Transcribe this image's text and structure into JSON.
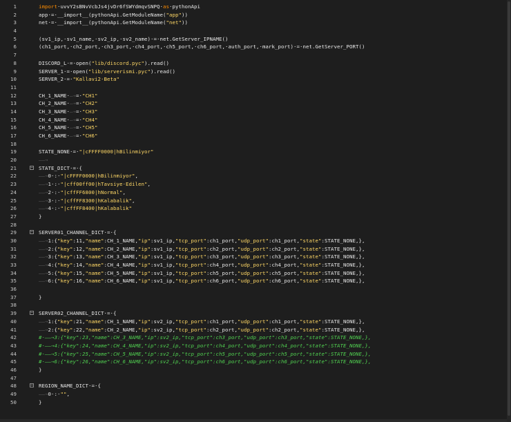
{
  "editor": {
    "lines": [
      {
        "n": "1",
        "code": "import·uvvY2sBNvVcbJs4jvDr6fSWYdmqvSNPQ·as·pythonApi",
        "type": "kw"
      },
      {
        "n": "2",
        "code": "app·=·__import__(pythonApi.GetModuleName(\"app\"))",
        "type": "normal"
      },
      {
        "n": "3",
        "code": "net·=·__import__(pythonApi.GetModuleName(\"net\"))",
        "type": "normal"
      },
      {
        "n": "4",
        "code": "",
        "type": "normal"
      },
      {
        "n": "5",
        "code": "(sv1_ip,·sv1_name,·sv2_ip,·sv2_name)·=·net.GetServer_IPNAME()",
        "type": "normal"
      },
      {
        "n": "6",
        "code": "(ch1_port,·ch2_port,·ch3_port,·ch4_port,·ch5_port,·ch6_port,·auth_port,·mark_port)·=·net.GetServer_PORT()",
        "type": "normal"
      },
      {
        "n": "7",
        "code": "",
        "type": "normal"
      },
      {
        "n": "8",
        "code": "DISCORD_L·=·open(\"lib/discord.pyc\").read()",
        "type": "normal"
      },
      {
        "n": "9",
        "code": "SERVER_1·=·open(\"lib/serverismi.pyc\").read()",
        "type": "normal"
      },
      {
        "n": "10",
        "code": "SERVER_2·=·\"Kallavi2·Beta\"",
        "type": "normal"
      },
      {
        "n": "11",
        "code": "",
        "type": "normal"
      },
      {
        "n": "12",
        "code": "CH_1_NAME·—→=·\"CH1\"",
        "type": "normal"
      },
      {
        "n": "13",
        "code": "CH_2_NAME·—→=·\"CH2\"",
        "type": "normal"
      },
      {
        "n": "14",
        "code": "CH_3_NAME·—→=·\"CH3\"",
        "type": "normal"
      },
      {
        "n": "15",
        "code": "CH_4_NAME·—→=·\"CH4\"",
        "type": "normal"
      },
      {
        "n": "16",
        "code": "CH_5_NAME·—→=·\"CH5\"",
        "type": "normal"
      },
      {
        "n": "17",
        "code": "CH_6_NAME·—→=·\"CH6\"",
        "type": "normal"
      },
      {
        "n": "18",
        "code": "",
        "type": "normal"
      },
      {
        "n": "19",
        "code": "STATE_NONE·=·\"|cFFFF0000|hBilinmiyor\"",
        "type": "normal"
      },
      {
        "n": "20",
        "code": "——→",
        "type": "normal"
      },
      {
        "n": "21",
        "code": "STATE_DICT·=·{",
        "type": "normal",
        "fold": true
      },
      {
        "n": "22",
        "code": "——→0·:·\"|cFFFF0000|hBilinmiyor\",",
        "type": "normal"
      },
      {
        "n": "23",
        "code": "——→1·:·\"|cff00ff00|hTavsiye·Edilen\",",
        "type": "normal"
      },
      {
        "n": "24",
        "code": "——→2·:·\"|cffFF6800|hNormal\",",
        "type": "normal"
      },
      {
        "n": "25",
        "code": "——→3·:·\"|cffFF8300|hKalabalik\",",
        "type": "normal"
      },
      {
        "n": "26",
        "code": "——→4·:·\"|cffFF8400|hKalabalik\"",
        "type": "normal"
      },
      {
        "n": "27",
        "code": "}",
        "type": "normal"
      },
      {
        "n": "28",
        "code": "",
        "type": "normal"
      },
      {
        "n": "29",
        "code": "SERVER01_CHANNEL_DICT·=·{",
        "type": "normal",
        "fold": true
      },
      {
        "n": "30",
        "code": "——→1:{\"key\":11,\"name\":CH_1_NAME,\"ip\":sv1_ip,\"tcp_port\":ch1_port,\"udp_port\":ch1_port,\"state\":STATE_NONE,},",
        "type": "normal"
      },
      {
        "n": "31",
        "code": "——→2:{\"key\":12,\"name\":CH_2_NAME,\"ip\":sv1_ip,\"tcp_port\":ch2_port,\"udp_port\":ch2_port,\"state\":STATE_NONE,},",
        "type": "normal"
      },
      {
        "n": "32",
        "code": "——→3:{\"key\":13,\"name\":CH_3_NAME,\"ip\":sv1_ip,\"tcp_port\":ch3_port,\"udp_port\":ch3_port,\"state\":STATE_NONE,},",
        "type": "normal"
      },
      {
        "n": "33",
        "code": "——→4:{\"key\":14,\"name\":CH_4_NAME,\"ip\":sv1_ip,\"tcp_port\":ch4_port,\"udp_port\":ch4_port,\"state\":STATE_NONE,},",
        "type": "normal"
      },
      {
        "n": "34",
        "code": "——→5:{\"key\":15,\"name\":CH_5_NAME,\"ip\":sv1_ip,\"tcp_port\":ch5_port,\"udp_port\":ch5_port,\"state\":STATE_NONE,},",
        "type": "normal"
      },
      {
        "n": "35",
        "code": "——→6:{\"key\":16,\"name\":CH_6_NAME,\"ip\":sv1_ip,\"tcp_port\":ch6_port,\"udp_port\":ch6_port,\"state\":STATE_NONE,},",
        "type": "normal"
      },
      {
        "n": "36",
        "code": "",
        "type": "normal"
      },
      {
        "n": "37",
        "code": "}",
        "type": "normal"
      },
      {
        "n": "38",
        "code": "",
        "type": "normal"
      },
      {
        "n": "39",
        "code": "SERVER02_CHANNEL_DICT·=·{",
        "type": "normal",
        "fold": true
      },
      {
        "n": "40",
        "code": "——→1:{\"key\":21,\"name\":CH_1_NAME,\"ip\":sv2_ip,\"tcp_port\":ch1_port,\"udp_port\":ch1_port,\"state\":STATE_NONE,},",
        "type": "normal"
      },
      {
        "n": "41",
        "code": "——→2:{\"key\":22,\"name\":CH_2_NAME,\"ip\":sv2_ip,\"tcp_port\":ch2_port,\"udp_port\":ch2_port,\"state\":STATE_NONE,},",
        "type": "normal"
      },
      {
        "n": "42",
        "code": "#·——→3:{\"key\":23,\"name\":CH_3_NAME,\"ip\":sv2_ip,\"tcp_port\":ch3_port,\"udp_port\":ch3_port,\"state\":STATE_NONE,},",
        "type": "comment"
      },
      {
        "n": "43",
        "code": "#·——→4:{\"key\":24,\"name\":CH_4_NAME,\"ip\":sv2_ip,\"tcp_port\":ch4_port,\"udp_port\":ch4_port,\"state\":STATE_NONE,},",
        "type": "comment"
      },
      {
        "n": "44",
        "code": "#·——→5:{\"key\":25,\"name\":CH_5_NAME,\"ip\":sv2_ip,\"tcp_port\":ch5_port,\"udp_port\":ch5_port,\"state\":STATE_NONE,},",
        "type": "comment"
      },
      {
        "n": "45",
        "code": "#·——→6:{\"key\":26,\"name\":CH_6_NAME,\"ip\":sv2_ip,\"tcp_port\":ch6_port,\"udp_port\":ch6_port,\"state\":STATE_NONE,},",
        "type": "comment"
      },
      {
        "n": "46",
        "code": "}",
        "type": "normal"
      },
      {
        "n": "47",
        "code": "",
        "type": "normal"
      },
      {
        "n": "48",
        "code": "REGION_NAME_DICT·=·{",
        "type": "normal",
        "fold": true
      },
      {
        "n": "49",
        "code": "——→0·:·\"\",",
        "type": "normal"
      },
      {
        "n": "50",
        "code": "}",
        "type": "normal"
      }
    ]
  },
  "colors": {
    "background": "#1e1e1e",
    "text": "#e8e8e8",
    "keyword": "#ff8c00",
    "string": "#ffd866",
    "comment": "#51d251",
    "line_number": "#c8c8c8"
  }
}
